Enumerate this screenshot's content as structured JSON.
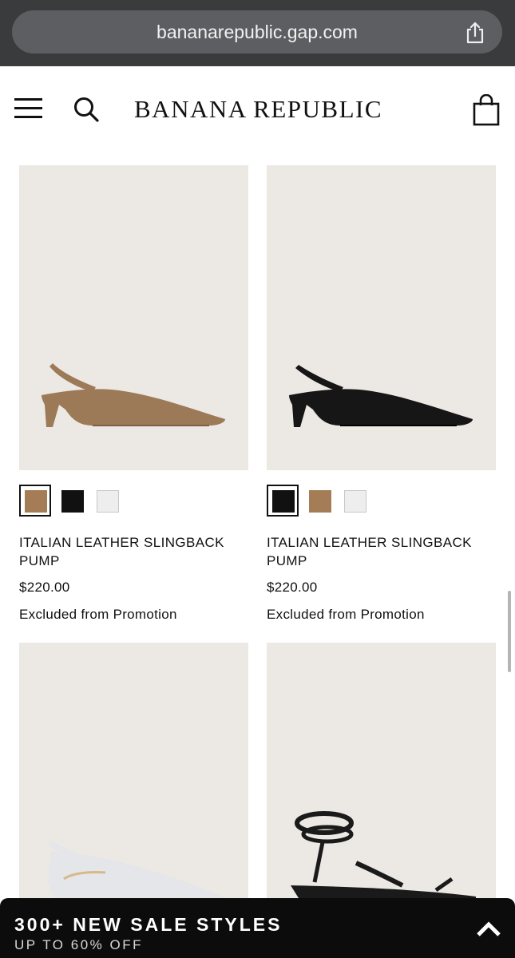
{
  "browser": {
    "url": "bananarepublic.gap.com",
    "share_icon": "share-icon"
  },
  "header": {
    "logo": "BANANA REPUBLIC",
    "menu_icon": "hamburger-menu-icon",
    "search_icon": "search-icon",
    "bag_icon": "shopping-bag-icon"
  },
  "products": [
    {
      "name": "ITALIAN LEATHER SLINGBACK PUMP",
      "price": "$220.00",
      "promo": "Excluded from Promotion",
      "swatches": [
        {
          "color": "#a47c55",
          "selected": true
        },
        {
          "color": "#111111",
          "selected": false
        },
        {
          "color": "#eeeeee",
          "selected": false
        }
      ],
      "shoe_color": "#9d7a57"
    },
    {
      "name": "ITALIAN LEATHER SLINGBACK PUMP",
      "price": "$220.00",
      "promo": "Excluded from Promotion",
      "swatches": [
        {
          "color": "#111111",
          "selected": true
        },
        {
          "color": "#a47c55",
          "selected": false
        },
        {
          "color": "#eeeeee",
          "selected": false
        }
      ],
      "shoe_color": "#161616"
    },
    {
      "shoe_color": "#e4e6ea"
    },
    {
      "shoe_color": "#1a1a1a"
    }
  ],
  "banner": {
    "title": "300+ NEW SALE STYLES",
    "subtitle": "UP TO 60% OFF",
    "icon": "chevron-up-icon"
  }
}
